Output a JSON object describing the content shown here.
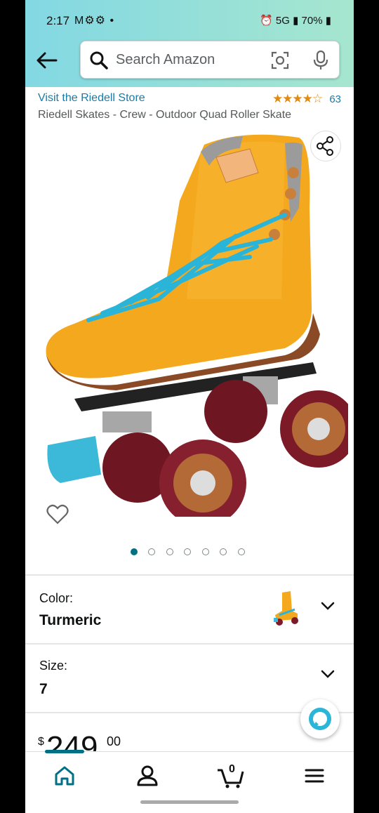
{
  "status_bar": {
    "time": "2:17",
    "left_icons": "M⚙⚙ •",
    "network": "5G",
    "battery": "70%"
  },
  "search": {
    "placeholder": "Search Amazon"
  },
  "product": {
    "store_link": "Visit the Riedell Store",
    "rating_stars": "★★★★☆",
    "rating_count": "63",
    "title": "Riedell Skates - Crew - Outdoor Quad Roller Skate",
    "image_count": 7,
    "active_image": 1
  },
  "options": {
    "color_label": "Color:",
    "color_value": "Turmeric",
    "size_label": "Size:",
    "size_value": "7"
  },
  "price": {
    "currency": "$",
    "whole": "249",
    "fraction": "00"
  },
  "bottom_nav": {
    "cart_count": "0",
    "items": [
      "home-icon",
      "account-icon",
      "cart-icon",
      "menu-icon"
    ]
  },
  "colors": {
    "header_start": "#82d8e3",
    "header_end": "#a6e6cf",
    "link": "#1b7aa6",
    "star": "#e18a12",
    "accent": "#007185"
  }
}
